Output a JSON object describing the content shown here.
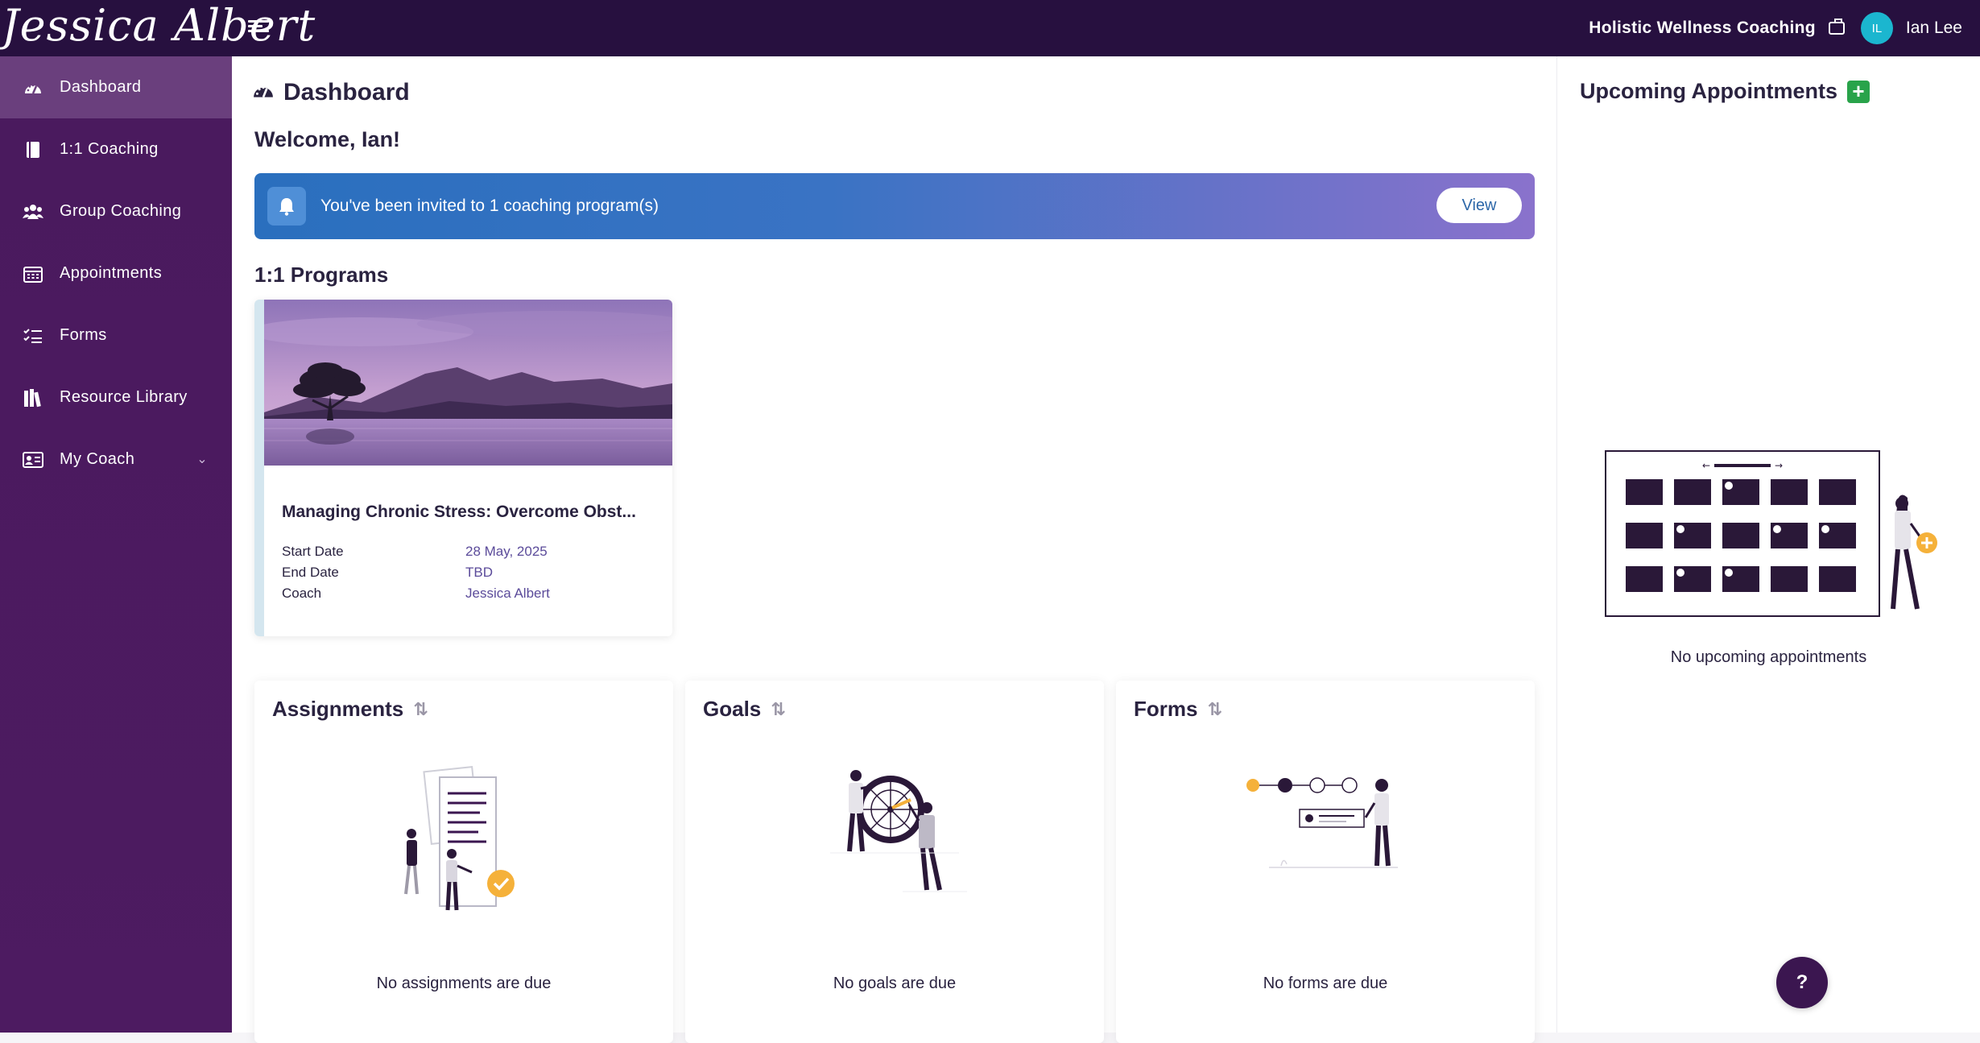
{
  "brand": {
    "name": "Jessica Albert"
  },
  "topbar": {
    "org_name": "Holistic Wellness Coaching",
    "avatar_initials": "IL",
    "user_name": "Ian Lee"
  },
  "sidebar": {
    "items": [
      {
        "label": "Dashboard",
        "icon": "dashboard-icon",
        "active": true
      },
      {
        "label": "1:1 Coaching",
        "icon": "book-icon"
      },
      {
        "label": "Group Coaching",
        "icon": "users-icon"
      },
      {
        "label": "Appointments",
        "icon": "calendar-icon"
      },
      {
        "label": "Forms",
        "icon": "checklist-icon"
      },
      {
        "label": "Resource Library",
        "icon": "library-icon"
      },
      {
        "label": "My Coach",
        "icon": "id-card-icon",
        "has_chevron": true
      }
    ]
  },
  "main": {
    "page_title": "Dashboard",
    "welcome": "Welcome, Ian!",
    "banner": {
      "text": "You've been invited to 1 coaching program(s)",
      "button": "View"
    },
    "programs_title": "1:1 Programs",
    "program": {
      "title": "Managing Chronic Stress: Overcome Obst...",
      "start_label": "Start Date",
      "start_value": "28 May, 2025",
      "end_label": "End Date",
      "end_value": "TBD",
      "coach_label": "Coach",
      "coach_value": "Jessica Albert"
    },
    "assignments": {
      "title": "Assignments",
      "empty": "No assignments are due"
    },
    "goals": {
      "title": "Goals",
      "empty": "No goals are due"
    },
    "forms": {
      "title": "Forms",
      "empty": "No forms are due"
    }
  },
  "right": {
    "title": "Upcoming Appointments",
    "empty": "No upcoming appointments"
  },
  "help": {
    "label": "?"
  },
  "colors": {
    "topbar": "#27103f",
    "sidebar": "#4a1a5e",
    "sidebar_active": "#6a3f7d",
    "add_green": "#29a34a",
    "accent_purple": "#3b1650"
  }
}
